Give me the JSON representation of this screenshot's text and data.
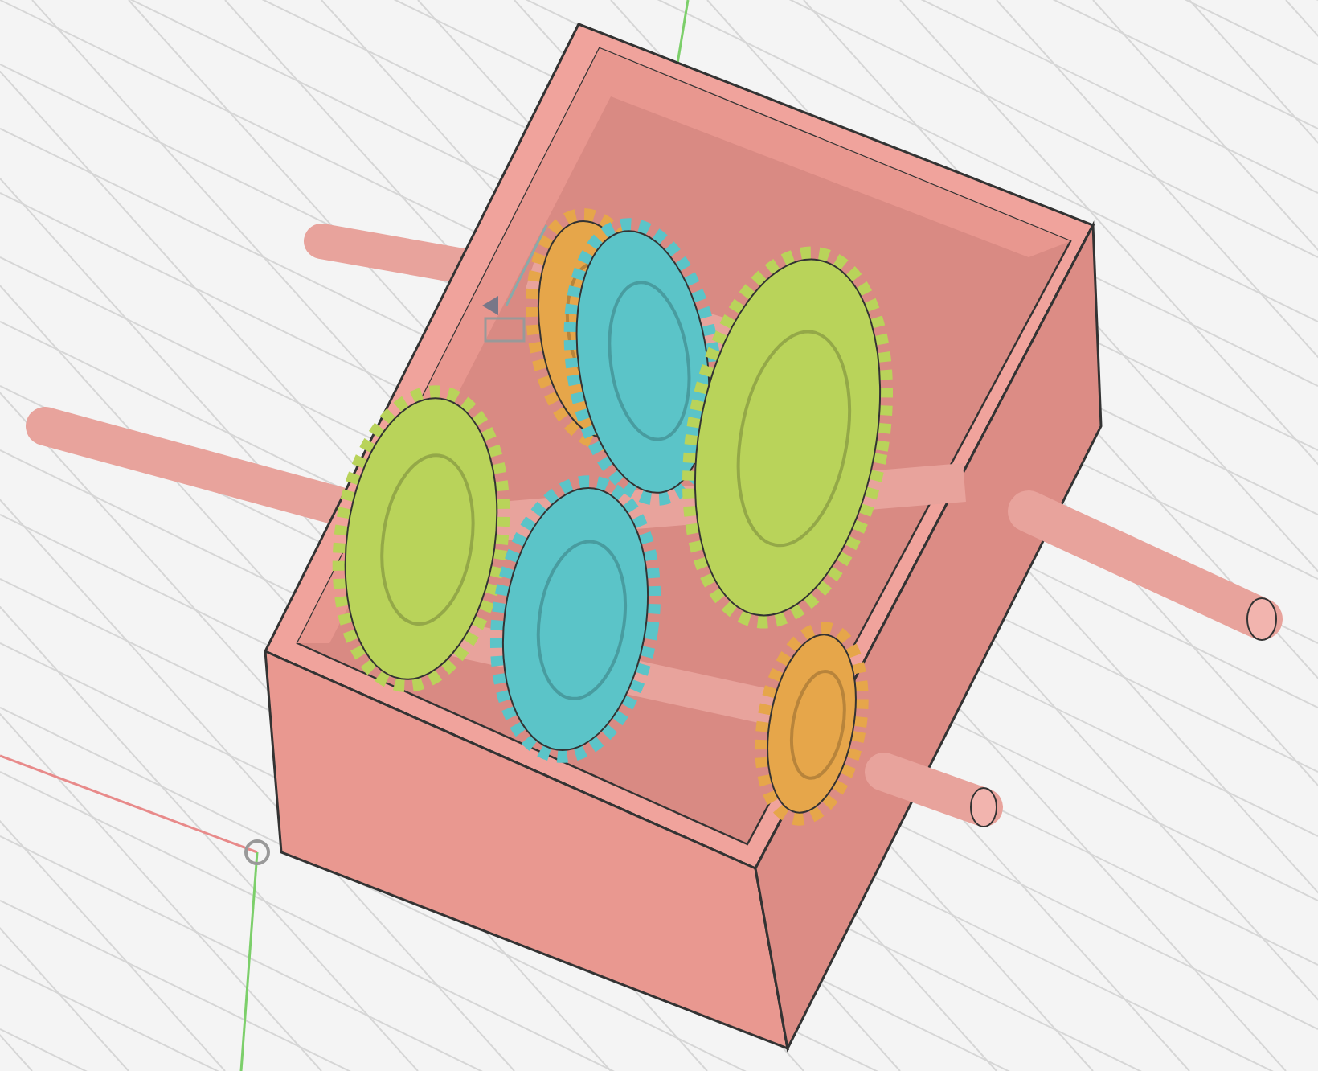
{
  "gears": [
    {
      "kind": "gear",
      "color": "#e6a64a"
    },
    {
      "kind": "gear",
      "color": "#5bc4c8"
    },
    {
      "kind": "gear",
      "color": "#b9d35a"
    },
    {
      "kind": "gear",
      "color": "#b9d35a"
    },
    {
      "kind": "gear",
      "color": "#5bc4c8"
    },
    {
      "kind": "gear",
      "color": "#e6a64a"
    }
  ]
}
